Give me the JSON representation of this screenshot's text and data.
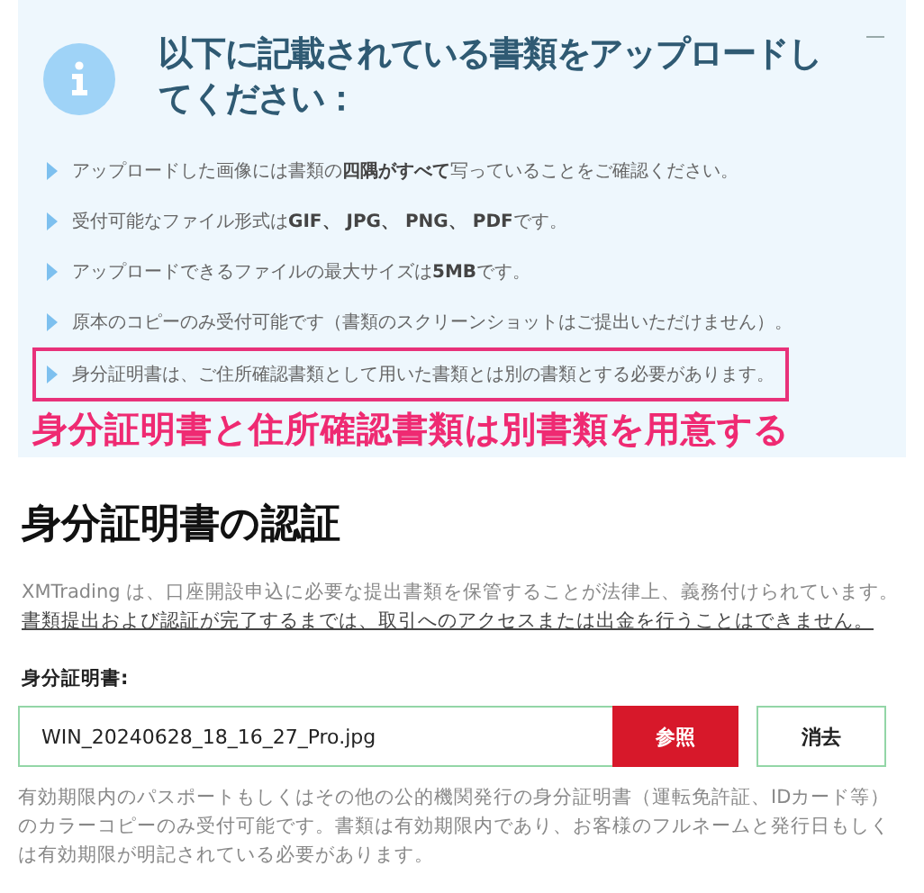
{
  "notice_panel": {
    "title": "以下に記載されている書類をアップロードしてください：",
    "items": [
      {
        "text": "アップロードした画像には書類の**四隅がすべて**写っていることをご確認ください。",
        "highlighted": false
      },
      {
        "text": "受付可能なファイル形式は**GIF、 JPG、 PNG、 PDF**です。",
        "highlighted": false
      },
      {
        "text": "アップロードできるファイルの最大サイズは**5MB**です。",
        "highlighted": false
      },
      {
        "text": "原本のコピーのみ受付可能です（書類のスクリーンショットはご提出いただけません）。",
        "highlighted": false
      },
      {
        "text": "身分証明書は、ご住所確認書類として用いた書類とは別の書類とする必要があります。",
        "highlighted": true
      }
    ],
    "annotation": "身分証明書と住所確認書類は別書類を用意する"
  },
  "section": {
    "title": "身分証明書の認証",
    "intro": "XMTrading は、口座開設申込に必要な提出書類を保管することが法律上、義務付けられています。",
    "notice": "書類提出および認証が完了するまでは、取引へのアクセスまたは出金を行うことはできません。",
    "field_label": "身分証明書:",
    "file_value": "WIN_20240628_18_16_27_Pro.jpg",
    "buttons": [
      "参照",
      "消去"
    ],
    "help": "有効期限内のパスポートもしくはその他の公的機関発行の身分証明書（運転免許証、IDカード等）のカラーコピーのみ受付可能です。書類は有効期限内であり、お客様のフルネームと発行日もしくは有効期限が明記されている必要があります。"
  }
}
